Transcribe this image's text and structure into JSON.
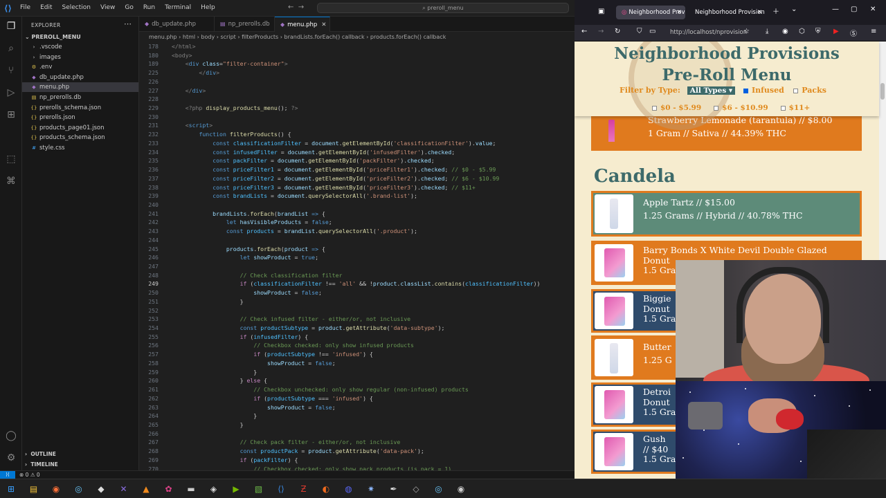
{
  "vscode": {
    "menu": [
      "File",
      "Edit",
      "Selection",
      "View",
      "Go",
      "Run",
      "Terminal",
      "Help"
    ],
    "search": "preroll_menu",
    "explorer_title": "EXPLORER",
    "folder": "PREROLL_MENU",
    "files": [
      {
        "name": ".vscode",
        "icon": "chevron-right-icon",
        "indent": 1
      },
      {
        "name": "images",
        "icon": "chevron-right-icon",
        "indent": 1
      },
      {
        "name": ".env",
        "icon": "gear-icon",
        "indent": 1
      },
      {
        "name": "db_update.php",
        "icon": "php-icon",
        "indent": 1
      },
      {
        "name": "menu.php",
        "icon": "php-icon",
        "indent": 1,
        "active": true
      },
      {
        "name": "np_prerolls.db",
        "icon": "database-icon",
        "indent": 1
      },
      {
        "name": "prerolls_schema.json",
        "icon": "json-icon",
        "indent": 1
      },
      {
        "name": "prerolls.json",
        "icon": "json-icon",
        "indent": 1
      },
      {
        "name": "products_page01.json",
        "icon": "json-icon",
        "indent": 1
      },
      {
        "name": "products_schema.json",
        "icon": "json-icon",
        "indent": 1
      },
      {
        "name": "style.css",
        "icon": "css-icon",
        "indent": 1
      }
    ],
    "outline": "OUTLINE",
    "timeline": "TIMELINE",
    "tabs": [
      {
        "name": "db_update.php",
        "active": false
      },
      {
        "name": "np_prerolls.db",
        "active": false
      },
      {
        "name": "menu.php",
        "active": true
      }
    ],
    "breadcrumbs": "menu.php  ›  html  ›  body  ›  script  ›  filterProducts  ›  brandLists.forEach() callback  ›  products.forEach() callback",
    "status": {
      "errors": "⊗ 0  ⚠ 0",
      "remote": "⟩⟨"
    },
    "code_lines": [
      {
        "n": "178",
        "h": "<span class=\"t\">&lt;/html&gt;</span>"
      },
      {
        "n": "180",
        "h": "<span class=\"t\">&lt;body&gt;</span>"
      },
      {
        "n": "189",
        "h": "    <span class=\"t\">&lt;</span><span class=\"k\">div</span> <span class=\"v\">class</span>=<span class=\"s\">\"filter-container\"</span><span class=\"t\">&gt;</span>"
      },
      {
        "n": "225",
        "h": "        <span class=\"t\">&lt;/</span><span class=\"k\">div</span><span class=\"t\">&gt;</span>"
      },
      {
        "n": "226",
        "h": ""
      },
      {
        "n": "227",
        "h": "    <span class=\"t\">&lt;/</span><span class=\"k\">div</span><span class=\"t\">&gt;</span>"
      },
      {
        "n": "228",
        "h": ""
      },
      {
        "n": "229",
        "h": "    <span class=\"t\">&lt;?php</span> <span class=\"f\">display_products_menu</span>(); <span class=\"t\">?&gt;</span>"
      },
      {
        "n": "230",
        "h": ""
      },
      {
        "n": "231",
        "h": "    <span class=\"t\">&lt;</span><span class=\"k\">script</span><span class=\"t\">&gt;</span>"
      },
      {
        "n": "232",
        "h": "        <span class=\"k\">function</span> <span class=\"f\">filterProducts</span>() {"
      },
      {
        "n": "233",
        "h": "            <span class=\"k\">const</span> <span class=\"cn\">classificationFilter</span> = <span class=\"v\">document</span>.<span class=\"f\">getElementById</span>(<span class=\"s\">'classificationFilter'</span>).<span class=\"v\">value</span>;"
      },
      {
        "n": "234",
        "h": "            <span class=\"k\">const</span> <span class=\"cn\">infusedFilter</span> = <span class=\"v\">document</span>.<span class=\"f\">getElementById</span>(<span class=\"s\">'infusedFilter'</span>).<span class=\"v\">checked</span>;"
      },
      {
        "n": "235",
        "h": "            <span class=\"k\">const</span> <span class=\"cn\">packFilter</span> = <span class=\"v\">document</span>.<span class=\"f\">getElementById</span>(<span class=\"s\">'packFilter'</span>).<span class=\"v\">checked</span>;"
      },
      {
        "n": "236",
        "h": "            <span class=\"k\">const</span> <span class=\"cn\">priceFilter1</span> = <span class=\"v\">document</span>.<span class=\"f\">getElementById</span>(<span class=\"s\">'priceFilter1'</span>).<span class=\"v\">checked</span>; <span class=\"c\">// $0 - $5.99</span>"
      },
      {
        "n": "237",
        "h": "            <span class=\"k\">const</span> <span class=\"cn\">priceFilter2</span> = <span class=\"v\">document</span>.<span class=\"f\">getElementById</span>(<span class=\"s\">'priceFilter2'</span>).<span class=\"v\">checked</span>; <span class=\"c\">// $6 - $10.99</span>"
      },
      {
        "n": "238",
        "h": "            <span class=\"k\">const</span> <span class=\"cn\">priceFilter3</span> = <span class=\"v\">document</span>.<span class=\"f\">getElementById</span>(<span class=\"s\">'priceFilter3'</span>).<span class=\"v\">checked</span>; <span class=\"c\">// $11+</span>"
      },
      {
        "n": "239",
        "h": "            <span class=\"k\">const</span> <span class=\"cn\">brandLists</span> = <span class=\"v\">document</span>.<span class=\"f\">querySelectorAll</span>(<span class=\"s\">'.brand-list'</span>);"
      },
      {
        "n": "240",
        "h": ""
      },
      {
        "n": "241",
        "h": "            <span class=\"v\">brandLists</span>.<span class=\"f\">forEach</span>(<span class=\"v\">brandList</span> <span class=\"k\">=&gt;</span> {"
      },
      {
        "n": "242",
        "h": "                <span class=\"k\">let</span> <span class=\"v\">hasVisibleProducts</span> = <span class=\"k\">false</span>;"
      },
      {
        "n": "243",
        "h": "                <span class=\"k\">const</span> <span class=\"cn\">products</span> = <span class=\"v\">brandList</span>.<span class=\"f\">querySelectorAll</span>(<span class=\"s\">'.product'</span>);"
      },
      {
        "n": "244",
        "h": ""
      },
      {
        "n": "245",
        "h": "                <span class=\"v\">products</span>.<span class=\"f\">forEach</span>(<span class=\"v\">product</span> <span class=\"k\">=&gt;</span> {"
      },
      {
        "n": "246",
        "h": "                    <span class=\"k\">let</span> <span class=\"v\">showProduct</span> = <span class=\"k\">true</span>;"
      },
      {
        "n": "247",
        "h": ""
      },
      {
        "n": "248",
        "h": "                    <span class=\"c\">// Check classification filter</span>"
      },
      {
        "n": "249",
        "h": "                    <span class=\"kw\">if</span> (<span class=\"cn\">classificationFilter</span> !== <span class=\"s\">'all'</span> &amp;&amp; !<span class=\"v\">product</span>.<span class=\"v\">classList</span>.<span class=\"f\">contains</span>(<span class=\"cn\">classificationFilter</span>))",
        "cur": true
      },
      {
        "n": "250",
        "h": "                        <span class=\"v\">showProduct</span> = <span class=\"k\">false</span>;"
      },
      {
        "n": "251",
        "h": "                    }"
      },
      {
        "n": "252",
        "h": ""
      },
      {
        "n": "253",
        "h": "                    <span class=\"c\">// Check infused filter - either/or, not inclusive</span>"
      },
      {
        "n": "254",
        "h": "                    <span class=\"k\">const</span> <span class=\"cn\">productSubtype</span> = <span class=\"v\">product</span>.<span class=\"f\">getAttribute</span>(<span class=\"s\">'data-subtype'</span>);"
      },
      {
        "n": "255",
        "h": "                    <span class=\"kw\">if</span> (<span class=\"cn\">infusedFilter</span>) {"
      },
      {
        "n": "256",
        "h": "                        <span class=\"c\">// Checkbox checked: only show infused products</span>"
      },
      {
        "n": "257",
        "h": "                        <span class=\"kw\">if</span> (<span class=\"cn\">productSubtype</span> !== <span class=\"s\">'infused'</span>) {"
      },
      {
        "n": "258",
        "h": "                            <span class=\"v\">showProduct</span> = <span class=\"k\">false</span>;"
      },
      {
        "n": "259",
        "h": "                        }"
      },
      {
        "n": "260",
        "h": "                    } <span class=\"kw\">else</span> {"
      },
      {
        "n": "261",
        "h": "                        <span class=\"c\">// Checkbox unchecked: only show regular (non-infused) products</span>"
      },
      {
        "n": "262",
        "h": "                        <span class=\"kw\">if</span> (<span class=\"cn\">productSubtype</span> === <span class=\"s\">'infused'</span>) {"
      },
      {
        "n": "263",
        "h": "                            <span class=\"v\">showProduct</span> = <span class=\"k\">false</span>;"
      },
      {
        "n": "264",
        "h": "                        }"
      },
      {
        "n": "265",
        "h": "                    }"
      },
      {
        "n": "266",
        "h": ""
      },
      {
        "n": "267",
        "h": "                    <span class=\"c\">// Check pack filter - either/or, not inclusive</span>"
      },
      {
        "n": "268",
        "h": "                    <span class=\"k\">const</span> <span class=\"cn\">productPack</span> = <span class=\"v\">product</span>.<span class=\"f\">getAttribute</span>(<span class=\"s\">'data-pack'</span>);"
      },
      {
        "n": "269",
        "h": "                    <span class=\"kw\">if</span> (<span class=\"cn\">packFilter</span>) {"
      },
      {
        "n": "270",
        "h": "                        <span class=\"c\">// Checkbox checked: only show pack products (is_pack = 1)</span>"
      }
    ]
  },
  "firefox": {
    "tabs": [
      {
        "title": "Neighborhood Provi",
        "active": true
      },
      {
        "title": "Neighborhood Provision",
        "active": false
      }
    ],
    "url": "http://localhost/nprovision"
  },
  "page": {
    "title_line1": "Neighborhood Provisions",
    "title_line2": "Pre-Roll Menu",
    "filter_label": "Filter by Type:",
    "type_select": "All Types ▾",
    "infused_label": "Infused",
    "packs_label": "Packs",
    "price_filters": [
      "$0 - $5.99",
      "$6 - $10.99",
      "$11+"
    ],
    "brand": "Candela",
    "products": [
      {
        "line1": "Strawberry Lemonade (tarantula) // $8.00",
        "line2": "1 Gram // Sativa // 44.39% THC",
        "thumb": "cone"
      },
      {
        "line1": "Apple Tartz // $15.00",
        "line2": "1.25 Grams // Hybrid // 40.78% THC",
        "thumb": "jar"
      },
      {
        "line1": "Barry Bonds X White Devil Double Glazed",
        "line2": "Donut",
        "line3": "1.5 Gra",
        "thumb": "bag"
      },
      {
        "line1": "Biggie",
        "line2": "Donut",
        "line3": "1.5 Gra",
        "thumb": "bag"
      },
      {
        "line1": "Butter",
        "line2": "1.25 G",
        "thumb": "jar"
      },
      {
        "line1": "Detroi",
        "line2": "Donut",
        "line3": "1.5 Gra",
        "thumb": "bag"
      },
      {
        "line1": "Gush",
        "line2": "// $40",
        "line3": "1.5 Gra",
        "thumb": "bag"
      }
    ]
  },
  "taskbar": {
    "icons": [
      "windows-start-icon",
      "file-explorer-icon",
      "firefox-icon",
      "steam-icon",
      "epic-games-icon",
      "xsplit-icon",
      "vlc-icon",
      "app-icon",
      "terminal-icon",
      "unity-icon",
      "nvidia-icon",
      "notepad-plus-icon",
      "vscode-icon",
      "filezilla-icon",
      "app2-icon",
      "discord-icon",
      "app3-icon",
      "inkscape-icon",
      "app4-icon",
      "steam2-icon",
      "obs-icon"
    ]
  }
}
